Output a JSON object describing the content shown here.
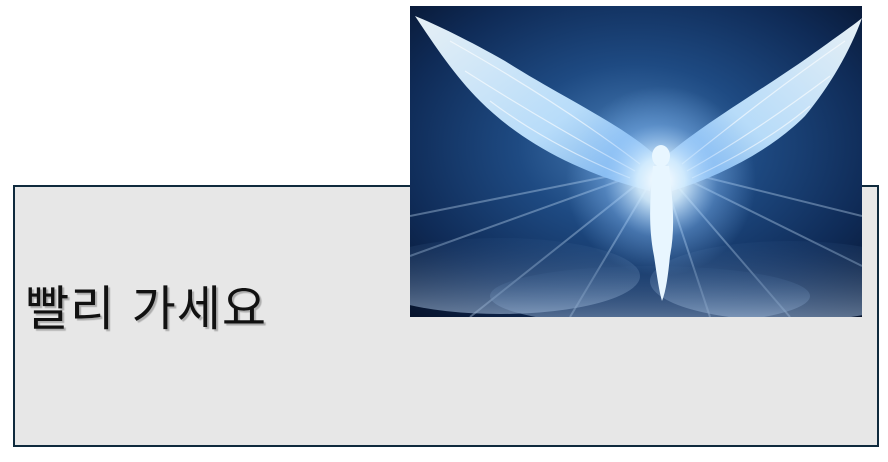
{
  "slide": {
    "message": "빨리 가세요"
  },
  "image": {
    "subject_icon": "angel-with-wings",
    "colors": {
      "sky_top": "#06122a",
      "sky_mid": "#163a6b",
      "glow": "#d9f0ff",
      "box_fill": "#e7e7e7",
      "box_border": "#0f2a3d"
    }
  }
}
